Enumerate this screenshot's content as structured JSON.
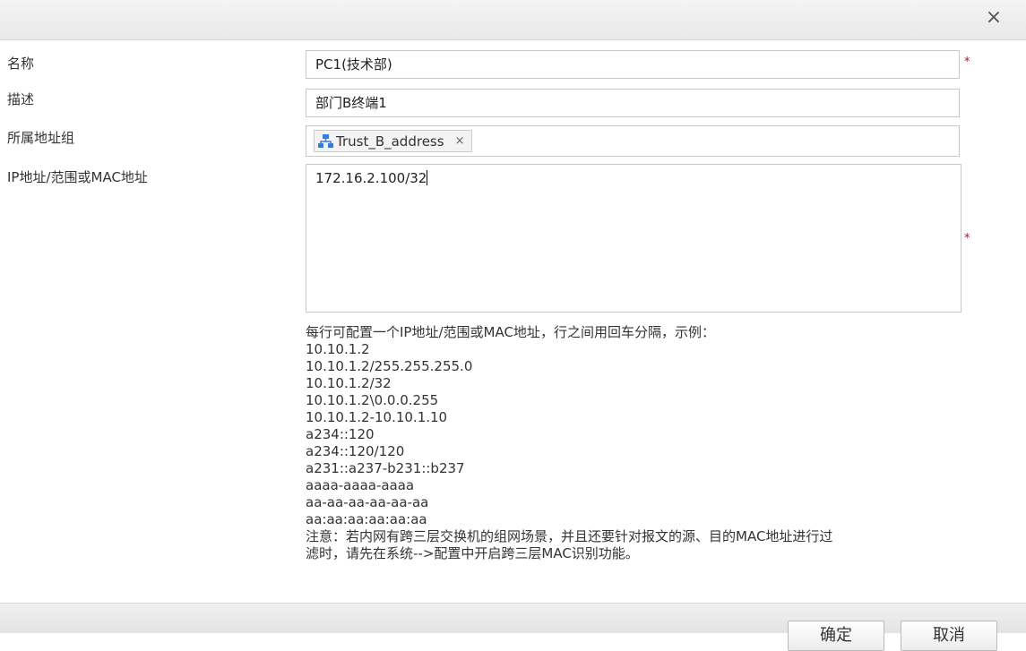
{
  "dialog": {
    "close_label": "×"
  },
  "form": {
    "name": {
      "label": "名称",
      "value": "PC1(技术部)"
    },
    "description": {
      "label": "描述",
      "value": "部门B终端1"
    },
    "group": {
      "label": "所属地址组",
      "tag": "Trust_B_address",
      "tag_remove": "×",
      "tag_icon": "network-group-icon"
    },
    "address": {
      "label": "IP地址/范围或MAC地址",
      "value": "172.16.2.100/32"
    },
    "required_mark": "*"
  },
  "help": {
    "lines": [
      "每行可配置一个IP地址/范围或MAC地址，行之间用回车分隔，示例：",
      "10.10.1.2",
      "10.10.1.2/255.255.255.0",
      "10.10.1.2/32",
      "10.10.1.2\\0.0.0.255",
      "10.10.1.2-10.10.1.10",
      "a234::120",
      "a234::120/120",
      "a231::a237-b231::b237",
      "aaaa-aaaa-aaaa",
      "aa-aa-aa-aa-aa-aa",
      "aa:aa:aa:aa:aa:aa",
      "注意：若内网有跨三层交换机的组网场景，并且还要针对报文的源、目的MAC地址进行过",
      "滤时，请先在系统-->配置中开启跨三层MAC识别功能。"
    ]
  },
  "buttons": {
    "ok": "确定",
    "cancel": "取消"
  },
  "colors": {
    "required": "#d9001b",
    "icon_blue": "#3a7bd5"
  }
}
